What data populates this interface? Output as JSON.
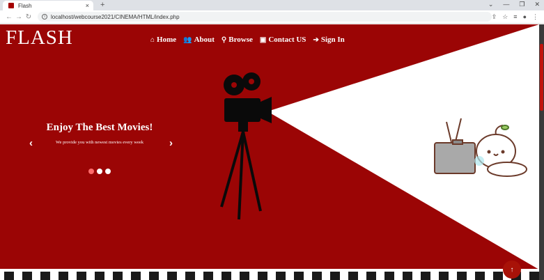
{
  "browser": {
    "tab_title": "Flash",
    "tab_close": "×",
    "new_tab": "+",
    "url": "localhost/webcourse2021/CINEMA/HTML/index.php",
    "window_controls": [
      "⌄",
      "—",
      "❐",
      "✕"
    ]
  },
  "header": {
    "brand": "FLASH",
    "nav": [
      {
        "icon": "home-icon",
        "glyph": "⌂",
        "label": "Home"
      },
      {
        "icon": "users-icon",
        "glyph": "👥",
        "label": "About"
      },
      {
        "icon": "search-icon",
        "glyph": "⚲",
        "label": "Browse"
      },
      {
        "icon": "contact-card-icon",
        "glyph": "▣",
        "label": "Contact US"
      },
      {
        "icon": "sign-in-icon",
        "glyph": "➔",
        "label": "Sign In"
      }
    ]
  },
  "hero": {
    "title": "Enjoy The Best Movies!",
    "subtitle": "We provide you with newest movies every week",
    "prev": "‹",
    "next": "›",
    "slides": 3,
    "active_slide": 1
  },
  "back_to_top": "↑",
  "colors": {
    "background": "#9b0505",
    "beam": "#ffffff",
    "accent": "#ff6b6b"
  }
}
